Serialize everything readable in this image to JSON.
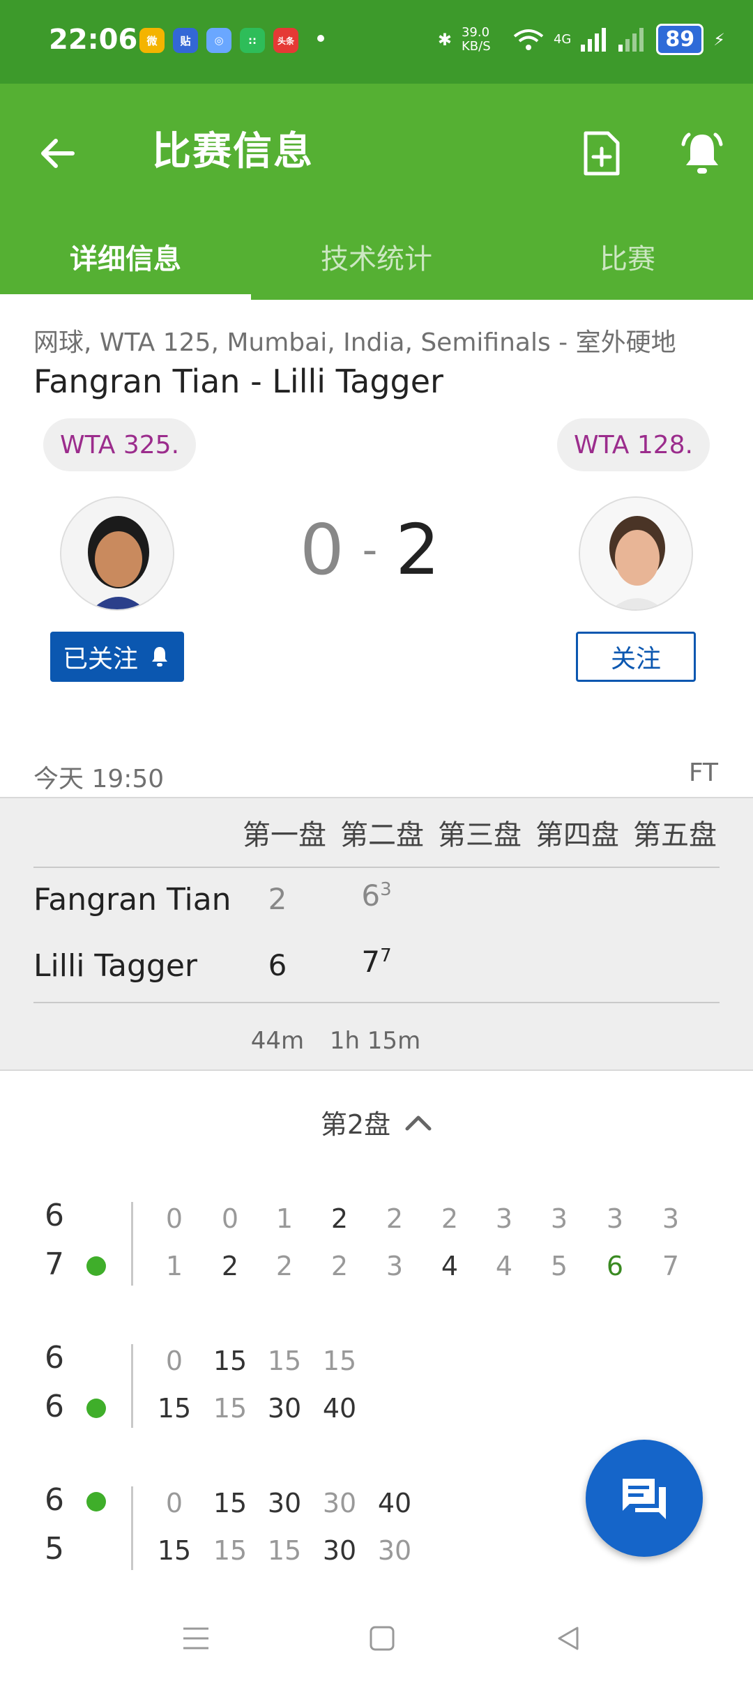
{
  "status_bar": {
    "time": "22:06",
    "app_badges": [
      "微",
      "贴",
      "◎",
      "::",
      "头条"
    ],
    "net_speed": "39.0 KB/S",
    "network": "4G",
    "battery": "89"
  },
  "appbar": {
    "title": "比赛信息",
    "tabs": [
      "详细信息",
      "技术统计",
      "比赛"
    ],
    "active_tab": 0,
    "colors": {
      "primary": "#55b033",
      "status": "#3d9a2b",
      "accent": "#0b57b0"
    }
  },
  "match": {
    "meta": "网球, WTA 125, Mumbai, India, Semifinals - 室外硬地",
    "title": "Fangran Tian - Lilli Tagger",
    "home_rank": "WTA 325.",
    "away_rank": "WTA 128.",
    "home_sets": "0",
    "separator": "-",
    "away_sets": "2",
    "home_follow": "已关注",
    "away_follow": "关注",
    "date": "今天 19:50",
    "status": "FT"
  },
  "sets_table": {
    "headers": [
      "第一盘",
      "第二盘",
      "第三盘",
      "第四盘",
      "第五盘"
    ],
    "players": [
      {
        "name": "Fangran Tian",
        "s1": "2",
        "s2": "6",
        "s2_tb": "3"
      },
      {
        "name": "Lilli Tagger",
        "s1": "6",
        "s2": "7",
        "s2_tb": "7"
      }
    ],
    "durations": [
      "44m",
      "1h 15m"
    ]
  },
  "set_detail": {
    "label": "第2盘",
    "blocks": [
      {
        "top": "6",
        "bottom": "7",
        "server": "bottom",
        "top_pts": [
          "0",
          "0",
          "1",
          "2",
          "2",
          "2",
          "3",
          "3",
          "3",
          "3"
        ],
        "bottom_pts": [
          "1",
          "2",
          "2",
          "2",
          "3",
          "4",
          "4",
          "5",
          "6",
          "7"
        ]
      },
      {
        "top": "6",
        "bottom": "6",
        "server": "bottom",
        "top_pts": [
          "0",
          "15",
          "15",
          "15"
        ],
        "bottom_pts": [
          "15",
          "15",
          "30",
          "40"
        ]
      },
      {
        "top": "6",
        "bottom": "5",
        "server": "top",
        "top_pts": [
          "0",
          "15",
          "30",
          "30",
          "40"
        ],
        "bottom_pts": [
          "15",
          "15",
          "15",
          "30",
          "30"
        ]
      }
    ]
  }
}
